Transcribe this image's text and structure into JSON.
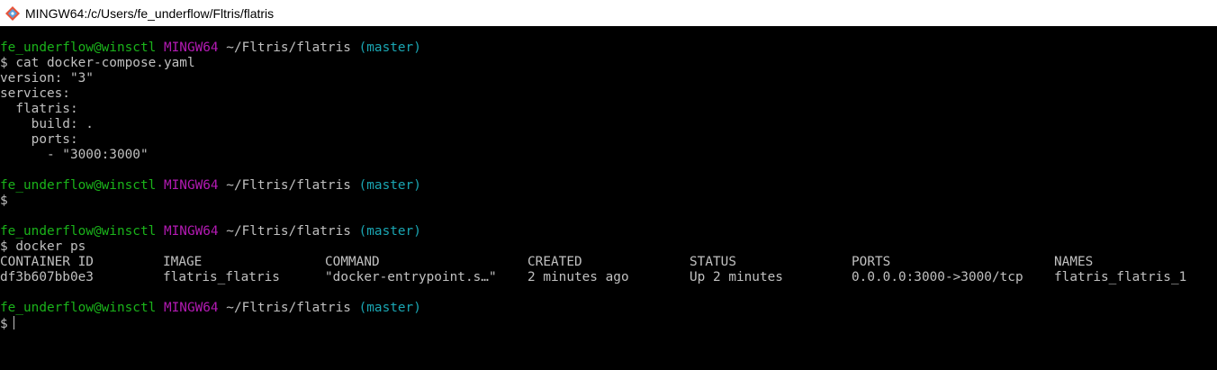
{
  "window": {
    "title": "MINGW64:/c/Users/fe_underflow/Fltris/flatris",
    "icon": "git-bash-icon"
  },
  "colors": {
    "background": "#000000",
    "text": "#c0c0c0",
    "user_host": "#1ab31a",
    "shell_name": "#b31ab3",
    "branch": "#1aa6b3"
  },
  "prompt": {
    "user_host": "fe_underflow@winsctl",
    "shell": "MINGW64",
    "path": "~/Fltris/flatris",
    "branch": "(master)",
    "symbol": "$"
  },
  "blocks": [
    {
      "command": "cat docker-compose.yaml",
      "output": [
        "version: \"3\"",
        "services:",
        "  flatris:",
        "    build: .",
        "    ports:",
        "      - \"3000:3000\""
      ]
    },
    {
      "command": ""
    },
    {
      "command": "docker ps"
    }
  ],
  "docker_ps": {
    "headers": [
      "CONTAINER ID",
      "IMAGE",
      "COMMAND",
      "CREATED",
      "STATUS",
      "PORTS",
      "NAMES"
    ],
    "rows": [
      [
        "df3b607bb0e3",
        "flatris_flatris",
        "\"docker-entrypoint.s…\"",
        "2 minutes ago",
        "Up 2 minutes",
        "0.0.0.0:3000->3000/tcp",
        "flatris_flatris_1"
      ]
    ]
  }
}
